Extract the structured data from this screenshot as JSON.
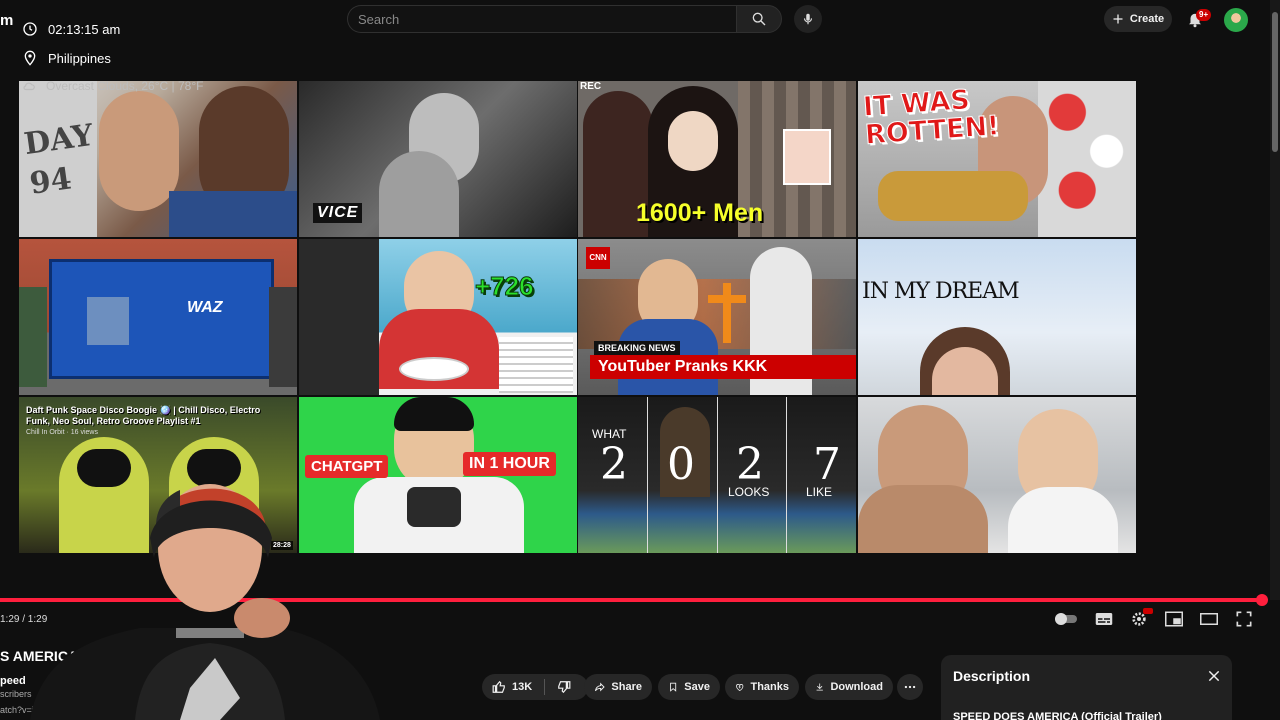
{
  "topbar": {
    "logo_fragment": "m",
    "search_placeholder": "Search",
    "create_label": "Create",
    "notifications_badge": "9+"
  },
  "overlay": {
    "time": "02:13:15 am",
    "location": "Philippines",
    "weather": "Overcast Clouds, 26°C | 78°F"
  },
  "thumbnails": [
    {
      "caption": "DAY 94"
    },
    {
      "caption": "VICE"
    },
    {
      "caption": "1600+ Men",
      "rec": "REC"
    },
    {
      "caption": "IT WAS ROTTEN!"
    },
    {
      "caption": "WAZ"
    },
    {
      "caption": "+726"
    },
    {
      "caption": "YouTuber Pranks KKK",
      "tag": "BREAKING NEWS",
      "brand": "CNN"
    },
    {
      "caption": "IN MY DREAM"
    },
    {
      "caption": "Daft Punk Space Disco Boogie 🪩 | Chill Disco, Electro Funk, Neo Soul, Retro Groove Playlist #1",
      "sub": "Chill In Orbit · 16 views",
      "duration": "28:28"
    },
    {
      "caption": "CHATGPT",
      "caption2": "IN 1 HOUR"
    },
    {
      "w1": "WHAT",
      "n1": "2",
      "n2": "0",
      "n3": "2",
      "w2": "LOOKS",
      "n4": "7",
      "w3": "LIKE"
    },
    {
      "caption": ""
    }
  ],
  "player": {
    "time": "1:29 / 1:29",
    "progress": 1.0
  },
  "video": {
    "title": "S AMERICA (",
    "channel": "peed",
    "subscribers": "scribers",
    "url_frag": "atch?v=i"
  },
  "actions": {
    "likes": "13K",
    "share": "Share",
    "save": "Save",
    "thanks": "Thanks",
    "download": "Download"
  },
  "description": {
    "title": "Description",
    "text": "SPEED DOES AMERICA (Official Trailer)"
  },
  "colors": {
    "accent": "#ff1f3d",
    "background": "#0f0f0f",
    "pill": "#272727"
  }
}
